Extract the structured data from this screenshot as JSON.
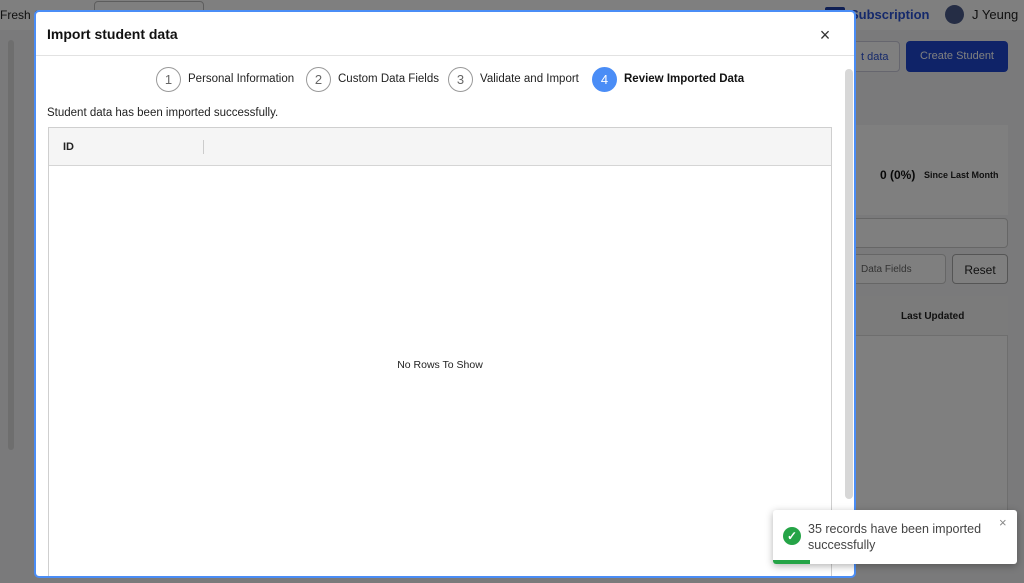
{
  "background": {
    "brand": "Fresh S",
    "subscription_label": "Subscription",
    "user_name": "J Yeung",
    "import_button": "t data",
    "create_button": "Create Student",
    "stat_value": "0 (0%)",
    "stat_label": "Since Last Month",
    "filter_label": "Data Fields",
    "reset_button": "Reset",
    "table_column": "Last Updated"
  },
  "modal": {
    "title": "Import student data",
    "close_symbol": "×",
    "steps": [
      {
        "number": "1",
        "label": "Personal Information",
        "active": false
      },
      {
        "number": "2",
        "label": "Custom Data Fields",
        "active": false
      },
      {
        "number": "3",
        "label": "Validate and Import",
        "active": false
      },
      {
        "number": "4",
        "label": "Review Imported Data",
        "active": true
      }
    ],
    "success_message": "Student data has been imported successfully.",
    "grid": {
      "columns": [
        "ID"
      ],
      "empty_message": "No Rows To Show"
    }
  },
  "toast": {
    "message": "35 records have been imported successfully",
    "check_symbol": "✓",
    "close_symbol": "×",
    "progress": 0.15,
    "color": "#25a447"
  },
  "colors": {
    "accent": "#4a8df6",
    "primary_button": "#1f47d0"
  }
}
